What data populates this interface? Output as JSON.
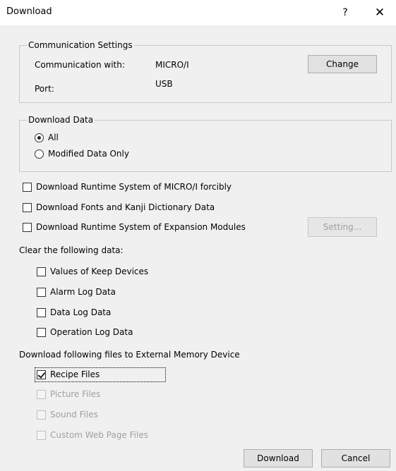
{
  "window": {
    "title": "Download",
    "help": "?",
    "close": "✕"
  },
  "communication": {
    "legend": "Communication Settings",
    "with_label": "Communication with:",
    "with_value": "MICRO/I",
    "port_label": "Port:",
    "port_value": "USB",
    "change_button": "Change"
  },
  "download_data": {
    "legend": "Download Data",
    "options": [
      {
        "label": "All",
        "selected": true
      },
      {
        "label": "Modified Data Only",
        "selected": false
      }
    ]
  },
  "options": {
    "runtime_forcibly": "Download Runtime System of MICRO/I forcibly",
    "fonts_kanji": "Download Fonts and Kanji Dictionary Data",
    "runtime_expansion": "Download Runtime System of Expansion Modules",
    "setting_button": "Setting..."
  },
  "clear": {
    "heading": "Clear the following data:",
    "items": [
      "Values of Keep Devices",
      "Alarm Log Data",
      "Data Log Data",
      "Operation Log Data"
    ]
  },
  "external": {
    "heading": "Download following files to External Memory Device",
    "items": [
      {
        "label": "Recipe Files",
        "checked": true,
        "enabled": true
      },
      {
        "label": "Picture Files",
        "checked": false,
        "enabled": false
      },
      {
        "label": "Sound Files",
        "checked": false,
        "enabled": false
      },
      {
        "label": "Custom Web Page Files",
        "checked": false,
        "enabled": false
      }
    ]
  },
  "footer": {
    "download_button": "Download",
    "cancel_button": "Cancel"
  }
}
